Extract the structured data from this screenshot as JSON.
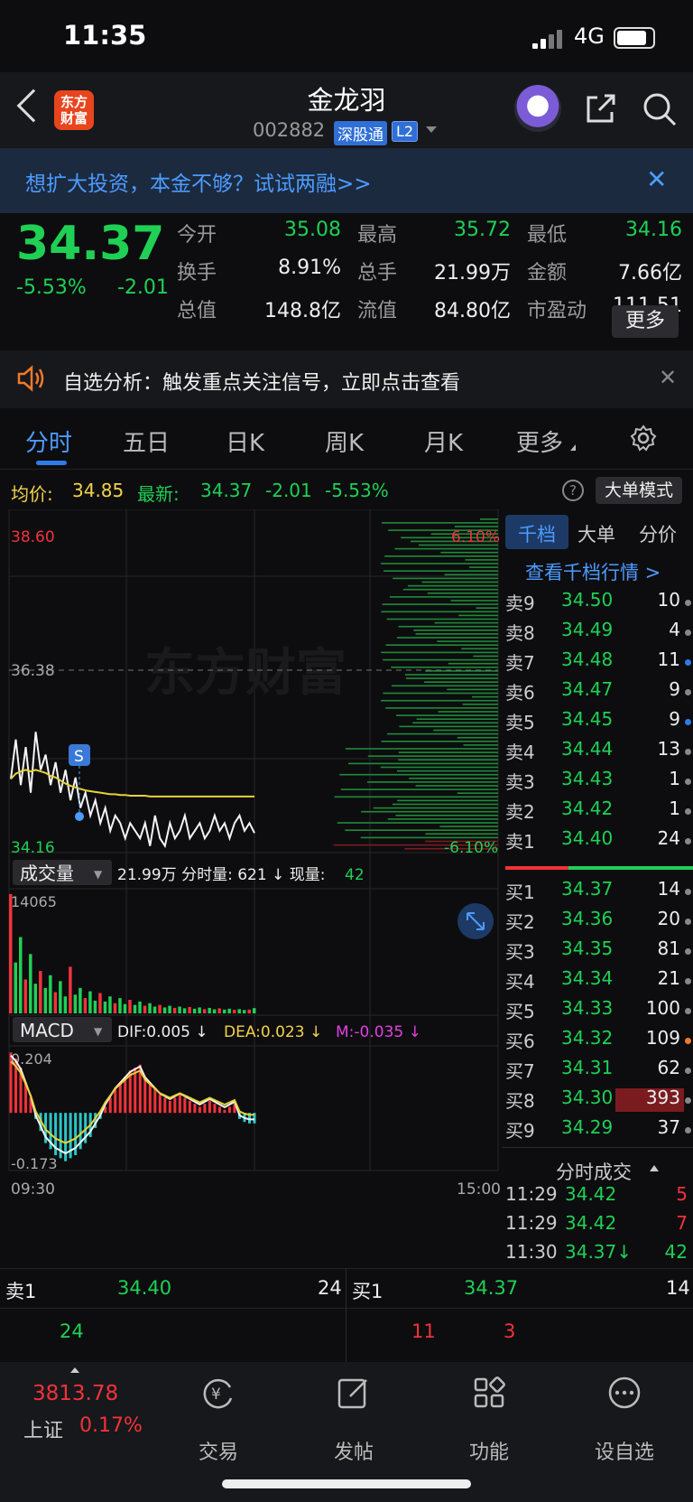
{
  "status": {
    "time": "11:35",
    "network": "4G"
  },
  "header": {
    "logo_text": "东方财富",
    "stock_name": "金龙羽",
    "stock_code": "002882",
    "tag_connect": "深股通",
    "tag_level": "L2"
  },
  "banner": {
    "text": "想扩大投资，本金不够？试试两融>>"
  },
  "quote": {
    "price": "34.37",
    "change_pct": "-5.53%",
    "change_amt": "-2.01",
    "fields": [
      {
        "label": "今开",
        "value": "35.08",
        "color": "#1fd055"
      },
      {
        "label": "最高",
        "value": "35.72",
        "color": "#1fd055"
      },
      {
        "label": "最低",
        "value": "34.16",
        "color": "#1fd055"
      },
      {
        "label": "换手",
        "value": "8.91%",
        "color": "#eeeeee"
      },
      {
        "label": "总手",
        "value": "21.99万",
        "color": "#eeeeee"
      },
      {
        "label": "金额",
        "value": "7.66亿",
        "color": "#eeeeee"
      },
      {
        "label": "总值",
        "value": "148.8亿",
        "color": "#eeeeee"
      },
      {
        "label": "流值",
        "value": "84.80亿",
        "color": "#eeeeee"
      },
      {
        "label": "市盈动",
        "value": "111.51",
        "color": "#eeeeee"
      }
    ],
    "more_label": "更多"
  },
  "analysis": {
    "text": "自选分析：触发重点关注信号，立即点击查看"
  },
  "tabs": [
    "分时",
    "五日",
    "日K",
    "周K",
    "月K",
    "更多"
  ],
  "avg_info": {
    "avg_label": "均价:",
    "avg_value": "34.85",
    "latest_label": "最新:",
    "latest_value": "34.37",
    "latest_chg": "-2.01",
    "latest_pct": "-5.53%",
    "big_mode": "大单模式"
  },
  "chart_data": {
    "type": "line",
    "price_axis": {
      "max": "38.60",
      "mid": "36.38",
      "min": "34.16",
      "pct_max": "6.10%",
      "pct_min": "-6.10%"
    },
    "watermark": "东方财富",
    "signal_marker": "S",
    "volume_label": "成交量",
    "volume_info": "21.99万 分时量: 621 ↓ 现量:",
    "volume_now": "42",
    "volume_max": "14065",
    "macd_label": "MACD",
    "dif": "DIF:0.005 ↓",
    "dea": "DEA:0.023 ↓",
    "m": "M:-0.035 ↓",
    "macd_max": "0.204",
    "macd_min": "-0.173",
    "time_start": "09:30",
    "time_end": "15:00",
    "price_series": [
      35.08,
      35.6,
      35.0,
      35.5,
      34.9,
      35.7,
      35.2,
      35.4,
      35.0,
      35.3,
      34.9,
      35.2,
      34.8,
      35.1,
      34.7,
      34.9,
      34.6,
      34.8,
      34.5,
      34.7,
      34.4,
      34.6,
      34.5,
      34.3,
      34.5,
      34.4,
      34.3,
      34.5,
      34.2,
      34.6,
      34.3,
      34.2,
      34.5,
      34.3,
      34.4,
      34.6,
      34.3,
      34.4,
      34.5,
      34.3,
      34.4,
      34.6,
      34.4,
      34.5,
      34.3,
      34.5,
      34.6,
      34.4,
      34.5,
      34.37
    ],
    "avg_series": [
      35.08,
      35.15,
      35.18,
      35.2,
      35.18,
      35.2,
      35.18,
      35.16,
      35.12,
      35.1,
      35.06,
      35.02,
      34.99,
      34.97,
      34.95,
      34.93,
      34.92,
      34.91,
      34.9,
      34.89,
      34.88,
      34.88,
      34.87,
      34.87,
      34.86,
      34.86,
      34.86,
      34.86,
      34.85,
      34.85,
      34.85,
      34.85,
      34.85,
      34.85,
      34.85,
      34.85,
      34.85,
      34.85,
      34.85,
      34.85,
      34.85,
      34.85,
      34.85,
      34.85,
      34.85,
      34.85,
      34.85,
      34.85,
      34.85,
      34.85
    ],
    "volume_series": [
      14065,
      6000,
      9000,
      4000,
      7000,
      3500,
      5000,
      3000,
      4500,
      2500,
      3800,
      2000,
      5500,
      2200,
      3000,
      1800,
      2600,
      1500,
      2400,
      1400,
      2000,
      1200,
      1800,
      1100,
      1600,
      1000,
      1400,
      900,
      1200,
      800,
      1000,
      700,
      900,
      650,
      800,
      600,
      750,
      550,
      700,
      500,
      650,
      480,
      600,
      450,
      550,
      420,
      500,
      400,
      450,
      621
    ],
    "macd_series": [
      0.2,
      0.18,
      0.15,
      0.1,
      0.05,
      -0.02,
      -0.06,
      -0.1,
      -0.12,
      -0.14,
      -0.15,
      -0.16,
      -0.15,
      -0.14,
      -0.12,
      -0.1,
      -0.08,
      -0.05,
      -0.02,
      0.02,
      0.05,
      0.08,
      0.1,
      0.12,
      0.14,
      0.15,
      0.16,
      0.12,
      0.1,
      0.08,
      0.06,
      0.05,
      0.04,
      0.05,
      0.06,
      0.05,
      0.04,
      0.03,
      0.02,
      0.03,
      0.04,
      0.03,
      0.02,
      0.01,
      0.02,
      0.03,
      -0.02,
      -0.03,
      -0.035,
      -0.035
    ]
  },
  "right_panel": {
    "tabs": [
      "千档",
      "大单",
      "分价"
    ],
    "depth_link": "查看千档行情 >",
    "asks": [
      {
        "label": "卖9",
        "price": "34.50",
        "vol": "10",
        "dot": "#888888"
      },
      {
        "label": "卖8",
        "price": "34.49",
        "vol": "4",
        "dot": "#888888"
      },
      {
        "label": "卖7",
        "price": "34.48",
        "vol": "11",
        "dot": "#2f7be8"
      },
      {
        "label": "卖6",
        "price": "34.47",
        "vol": "9",
        "dot": "#888888"
      },
      {
        "label": "卖5",
        "price": "34.45",
        "vol": "9",
        "dot": "#2f7be8"
      },
      {
        "label": "卖4",
        "price": "34.44",
        "vol": "13",
        "dot": "#888888"
      },
      {
        "label": "卖3",
        "price": "34.43",
        "vol": "1",
        "dot": "#888888"
      },
      {
        "label": "卖2",
        "price": "34.42",
        "vol": "1",
        "dot": "#888888"
      },
      {
        "label": "卖1",
        "price": "34.40",
        "vol": "24",
        "dot": "#888888"
      }
    ],
    "bids": [
      {
        "label": "买1",
        "price": "34.37",
        "vol": "14",
        "dot": "#888888"
      },
      {
        "label": "买2",
        "price": "34.36",
        "vol": "20",
        "dot": "#888888"
      },
      {
        "label": "买3",
        "price": "34.35",
        "vol": "81",
        "dot": "#888888"
      },
      {
        "label": "买4",
        "price": "34.34",
        "vol": "21",
        "dot": "#888888"
      },
      {
        "label": "买5",
        "price": "34.33",
        "vol": "100",
        "dot": "#888888"
      },
      {
        "label": "买6",
        "price": "34.32",
        "vol": "109",
        "dot": "#f07a2a"
      },
      {
        "label": "买7",
        "price": "34.31",
        "vol": "62",
        "dot": "#888888"
      },
      {
        "label": "买8",
        "price": "34.30",
        "vol": "393",
        "dot": "#888888"
      },
      {
        "label": "买9",
        "price": "34.29",
        "vol": "37",
        "dot": "#888888"
      }
    ],
    "trades_title": "分时成交",
    "trades": [
      {
        "time": "11:29",
        "price": "34.42",
        "vol": "5"
      },
      {
        "time": "11:29",
        "price": "34.42",
        "vol": "7"
      },
      {
        "time": "11:30",
        "price": "34.37↓",
        "vol": "42"
      }
    ]
  },
  "bottom_quotes": {
    "ask_label": "卖1",
    "ask_price": "34.40",
    "ask_vol": "24",
    "ask_sub": "24",
    "bid_label": "买1",
    "bid_price": "34.37",
    "bid_vol": "14",
    "bid_sub1": "11",
    "bid_sub2": "3"
  },
  "nav": {
    "index_value": "3813.78",
    "index_name": "上证",
    "index_pct": "0.17%",
    "items": [
      "交易",
      "发帖",
      "功能",
      "设自选"
    ]
  }
}
